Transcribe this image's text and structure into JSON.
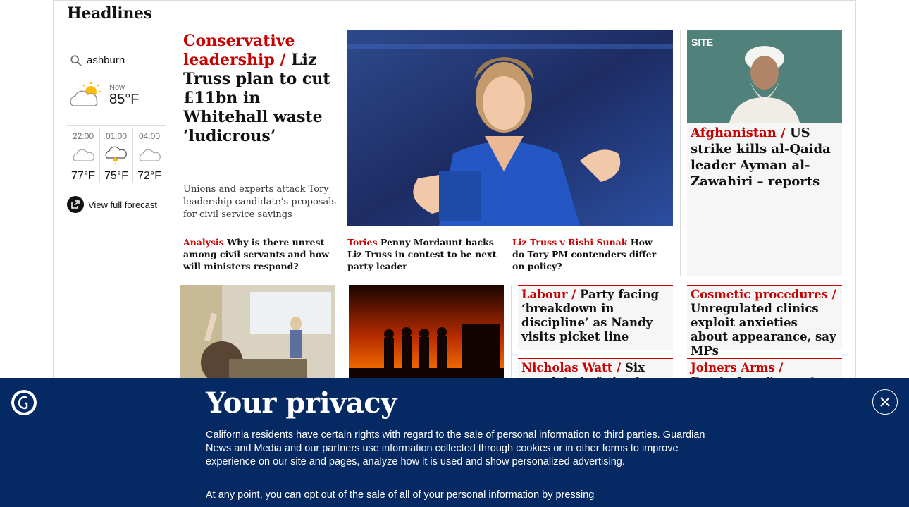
{
  "section": {
    "title": "Headlines"
  },
  "weather": {
    "location": "ashburn",
    "now_label": "Now",
    "now_temp": "85°F",
    "forecast": [
      {
        "time": "22:00",
        "temp": "77°F",
        "icon": "cloud-moon-icon"
      },
      {
        "time": "01:00",
        "temp": "75°F",
        "icon": "thunderstorm-icon"
      },
      {
        "time": "04:00",
        "temp": "72°F",
        "icon": "cloud-moon-icon"
      }
    ],
    "full_forecast_label": "View full forecast"
  },
  "lead": {
    "kicker": "Conservative leadership /",
    "headline": "Liz Truss plan to cut £11bn in Whitehall waste ‘ludicrous’",
    "standfirst": "Unions and experts attack Tory leadership candidate’s proposals for civil service savings",
    "sublinks": [
      {
        "kicker": "Analysis",
        "text": "Why is there unrest among civil servants and how will ministers respond?"
      },
      {
        "kicker": "Tories",
        "text": "Penny Mordaunt backs Liz Truss in contest to be next party leader"
      },
      {
        "kicker": "Liz Truss v Rishi Sunak",
        "text": "How do Tory PM contenders differ on policy?"
      }
    ]
  },
  "stories": {
    "afghanistan": {
      "kicker": "Afghanistan /",
      "headline": "US strike kills al-Qaida leader Ayman al-Zawahiri – reports",
      "image_watermark": "SITE"
    },
    "labour": {
      "kicker": "Labour /",
      "headline": "Party facing ‘breakdown in discipline’ as Nandy visits picket line"
    },
    "cosmetic": {
      "kicker": "Cosmetic procedures /",
      "headline": "Unregulated clinics exploit anxieties about appearance, say MPs"
    },
    "nicholas": {
      "kicker": "Nicholas Watt /",
      "headline": "Six convicted of abusing BBC"
    },
    "joiners": {
      "kicker": "Joiners Arms /",
      "headline": "Fundraiser for east London gay bar"
    }
  },
  "privacy": {
    "title": "Your privacy",
    "body": "California residents have certain rights with regard to the sale of personal information to third parties. Guardian News and Media and our partners use information collected through cookies or in other forms to improve experience on our site and pages, analyze how it is used and show personalized advertising.",
    "body2": "At any point, you can opt out of the sale of all of your personal information by pressing"
  }
}
